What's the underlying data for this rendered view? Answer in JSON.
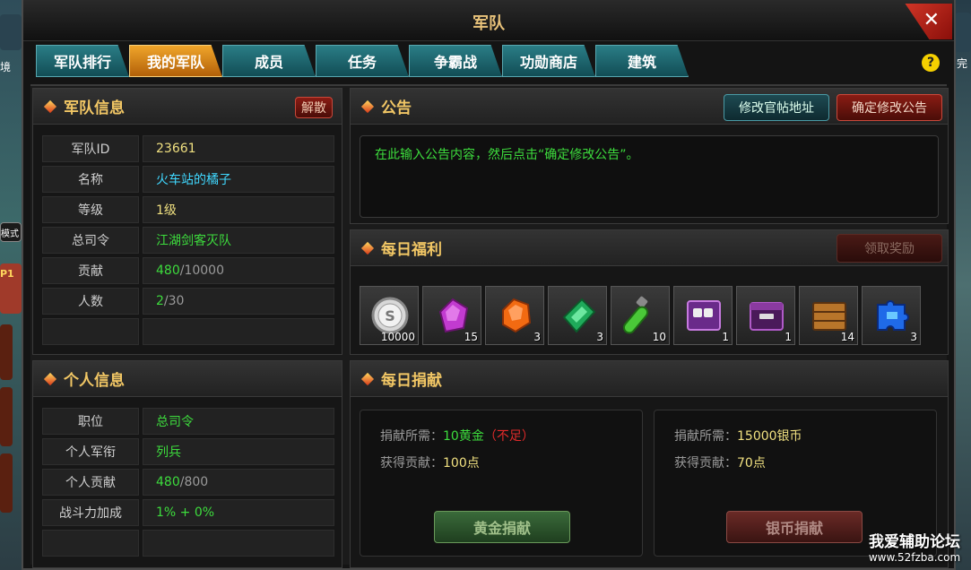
{
  "window": {
    "title": "军队",
    "close": "✕",
    "help": "?"
  },
  "tabs": [
    "军队排行",
    "我的军队",
    "成员",
    "任务",
    "争霸战",
    "功勋商店",
    "建筑"
  ],
  "active_tab": 1,
  "army_info": {
    "title": "军队信息",
    "disband": "解散",
    "rows": [
      {
        "key": "军队ID",
        "value": "23661",
        "color": "#f0e080"
      },
      {
        "key": "名称",
        "value": "火车站的橘子",
        "color": "#40d8ff"
      },
      {
        "key": "等级",
        "value": "1级",
        "color": "#f0e080"
      },
      {
        "key": "总司令",
        "value": "江湖剑客灭队",
        "color": "#3ddc3d"
      },
      {
        "key": "贡献",
        "value_a": "480",
        "value_b": "/10000"
      },
      {
        "key": "人数",
        "value_a": "2",
        "value_b": "/30"
      },
      {
        "key": "",
        "value": ""
      }
    ]
  },
  "personal_info": {
    "title": "个人信息",
    "rows": [
      {
        "key": "职位",
        "value": "总司令",
        "color": "#3ddc3d"
      },
      {
        "key": "个人军衔",
        "value": "列兵",
        "color": "#3ddc3d"
      },
      {
        "key": "个人贡献",
        "value_a": "480",
        "value_b": "/800"
      },
      {
        "key": "战斗力加成",
        "value": "1% + 0%",
        "color": "#3ddc3d"
      },
      {
        "key": "",
        "value": ""
      }
    ]
  },
  "notice": {
    "title": "公告",
    "btn_forum": "修改官帖地址",
    "btn_confirm": "确定修改公告",
    "text": "在此输入公告内容，然后点击“确定修改公告”。"
  },
  "daily_welfare": {
    "title": "每日福利",
    "claim": "领取奖励",
    "items": [
      {
        "icon": "silver-coin-icon",
        "count": "10000"
      },
      {
        "icon": "purple-gem-icon",
        "count": "15"
      },
      {
        "icon": "orange-gem-icon",
        "count": "3"
      },
      {
        "icon": "green-crystal-icon",
        "count": "3"
      },
      {
        "icon": "green-potion-icon",
        "count": "10"
      },
      {
        "icon": "purple-box-icon",
        "count": "1"
      },
      {
        "icon": "purple-chest-icon",
        "count": "1"
      },
      {
        "icon": "wooden-crate-icon",
        "count": "14"
      },
      {
        "icon": "blue-puzzle-icon",
        "count": "3"
      }
    ]
  },
  "daily_donation": {
    "title": "每日捐献",
    "gold": {
      "need_label": "捐献所需：",
      "need_value": "10黄金",
      "insufficient": "（不足）",
      "gain_label": "获得贡献：",
      "gain_value": "100点",
      "button": "黄金捐献"
    },
    "silver": {
      "need_label": "捐献所需：",
      "need_value": "15000银币",
      "gain_label": "获得贡献：",
      "gain_value": "70点",
      "button": "银币捐献"
    }
  },
  "watermark": {
    "line1": "我爱辅助论坛",
    "line2": "www.52fzba.com"
  },
  "side_left": {
    "label1": "境",
    "label2": "模式",
    "badge": "P1"
  },
  "side_right": {
    "label1": "完"
  }
}
